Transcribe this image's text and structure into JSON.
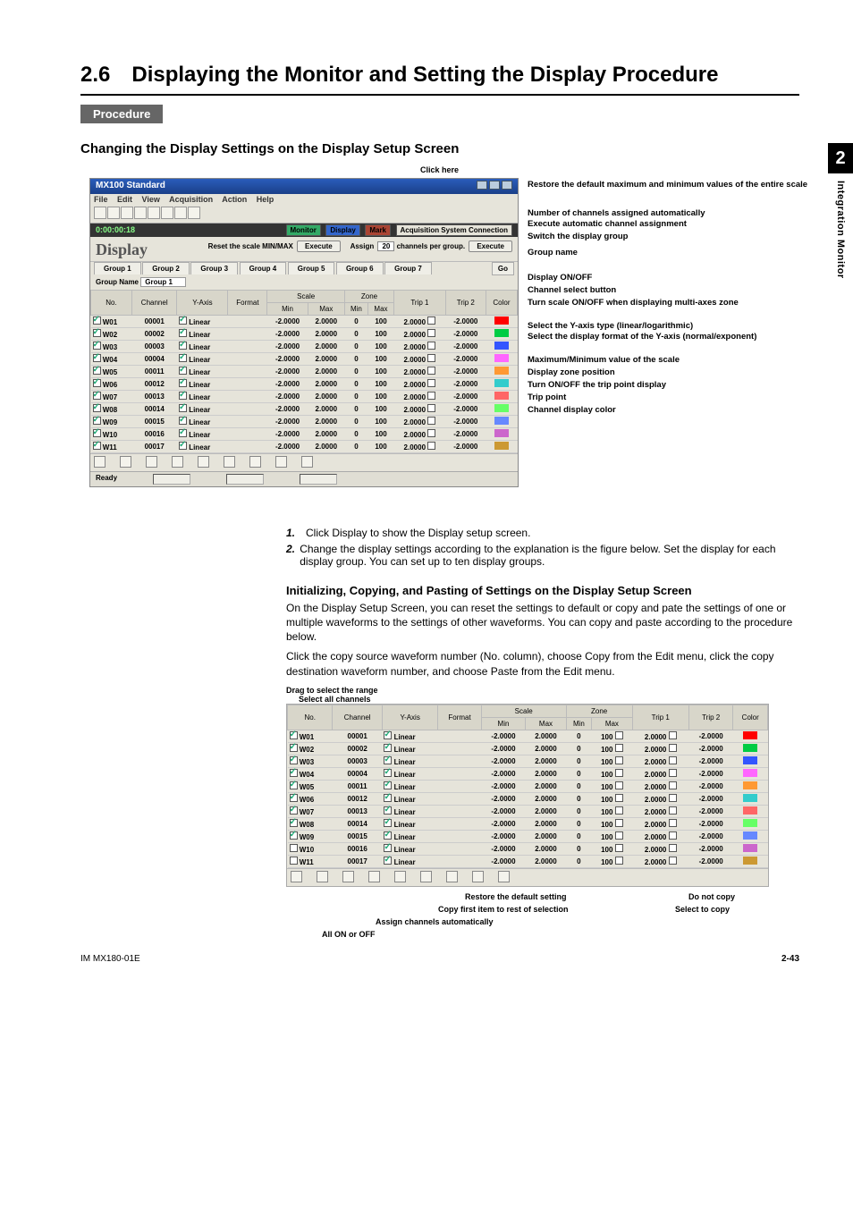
{
  "side_tab": {
    "number": "2",
    "label": "Integration Monitor"
  },
  "section": {
    "number": "2.6",
    "title": "Displaying the Monitor and Setting the Display Procedure"
  },
  "labels": {
    "procedure": "Procedure"
  },
  "subhead1": "Changing the Display Settings on the Display Setup Screen",
  "fig1": {
    "click_here": "Click here",
    "window_title": "MX100 Standard",
    "menu": [
      "File",
      "Edit",
      "View",
      "Acquisition",
      "Action",
      "Help"
    ],
    "time": "0:00:00:18",
    "top_buttons": {
      "monitor": "Monitor",
      "display": "Display",
      "mark": "Mark",
      "rest": "Acquisition  System  Connection"
    },
    "display_word": "Display",
    "reset_label": "Reset the scale MIN/MAX",
    "execute": "Execute",
    "assign_label": "Assign",
    "assign_value": "20",
    "assign_suffix": "channels per group.",
    "go_btn": "Go",
    "group_tabs": [
      "Group 1",
      "Group 2",
      "Group 3",
      "Group 4",
      "Group 5",
      "Group 6",
      "Group 7"
    ],
    "group_name_label": "Group Name",
    "group_name_value": "Group 1",
    "headers": [
      "No.",
      "Channel",
      "Y-Axis",
      "Format",
      "Scale Min",
      "Scale Max",
      "Zone Min",
      "Zone Max",
      "Trip 1",
      "Trip 2",
      "Color"
    ],
    "scale_hdr": "Scale",
    "zone_hdr": "Zone",
    "rows": [
      {
        "no": "W01",
        "ch": "00001",
        "yaxis": "Linear",
        "smin": "-2.0000",
        "smax": "2.0000",
        "zmin": "0",
        "zmax": "100",
        "t1": "2.0000",
        "t2": "-2.0000",
        "color": "#ff0000"
      },
      {
        "no": "W02",
        "ch": "00002",
        "yaxis": "Linear",
        "smin": "-2.0000",
        "smax": "2.0000",
        "zmin": "0",
        "zmax": "100",
        "t1": "2.0000",
        "t2": "-2.0000",
        "color": "#00cc44"
      },
      {
        "no": "W03",
        "ch": "00003",
        "yaxis": "Linear",
        "smin": "-2.0000",
        "smax": "2.0000",
        "zmin": "0",
        "zmax": "100",
        "t1": "2.0000",
        "t2": "-2.0000",
        "color": "#3355ff"
      },
      {
        "no": "W04",
        "ch": "00004",
        "yaxis": "Linear",
        "smin": "-2.0000",
        "smax": "2.0000",
        "zmin": "0",
        "zmax": "100",
        "t1": "2.0000",
        "t2": "-2.0000",
        "color": "#ff66ff"
      },
      {
        "no": "W05",
        "ch": "00011",
        "yaxis": "Linear",
        "smin": "-2.0000",
        "smax": "2.0000",
        "zmin": "0",
        "zmax": "100",
        "t1": "2.0000",
        "t2": "-2.0000",
        "color": "#ff9933"
      },
      {
        "no": "W06",
        "ch": "00012",
        "yaxis": "Linear",
        "smin": "-2.0000",
        "smax": "2.0000",
        "zmin": "0",
        "zmax": "100",
        "t1": "2.0000",
        "t2": "-2.0000",
        "color": "#33cccc"
      },
      {
        "no": "W07",
        "ch": "00013",
        "yaxis": "Linear",
        "smin": "-2.0000",
        "smax": "2.0000",
        "zmin": "0",
        "zmax": "100",
        "t1": "2.0000",
        "t2": "-2.0000",
        "color": "#ff6666"
      },
      {
        "no": "W08",
        "ch": "00014",
        "yaxis": "Linear",
        "smin": "-2.0000",
        "smax": "2.0000",
        "zmin": "0",
        "zmax": "100",
        "t1": "2.0000",
        "t2": "-2.0000",
        "color": "#66ff66"
      },
      {
        "no": "W09",
        "ch": "00015",
        "yaxis": "Linear",
        "smin": "-2.0000",
        "smax": "2.0000",
        "zmin": "0",
        "zmax": "100",
        "t1": "2.0000",
        "t2": "-2.0000",
        "color": "#6688ff"
      },
      {
        "no": "W10",
        "ch": "00016",
        "yaxis": "Linear",
        "smin": "-2.0000",
        "smax": "2.0000",
        "zmin": "0",
        "zmax": "100",
        "t1": "2.0000",
        "t2": "-2.0000",
        "color": "#cc66cc"
      },
      {
        "no": "W11",
        "ch": "00017",
        "yaxis": "Linear",
        "smin": "-2.0000",
        "smax": "2.0000",
        "zmin": "0",
        "zmax": "100",
        "t1": "2.0000",
        "t2": "-2.0000",
        "color": "#cc9933"
      }
    ],
    "status": "Ready",
    "annotations": [
      "Restore the default maximum and minimum values of the entire scale",
      "Number of channels assigned automatically",
      "Execute automatic channel assignment",
      "Switch the display group",
      "Group name",
      "Display ON/OFF",
      "Channel select button",
      "Turn scale ON/OFF when displaying multi-axes zone",
      "Select the Y-axis type (linear/logarithmic)",
      "Select the display format of the Y-axis (normal/exponent)",
      "Maximum/Minimum value of the scale",
      "Display zone position",
      "Turn ON/OFF the trip point display",
      "Trip point",
      "Channel display color"
    ]
  },
  "steps": [
    {
      "n": "1.",
      "t": "Click Display to show the Display setup screen."
    },
    {
      "n": "2.",
      "t": "Change the display settings according to the explanation is the figure below. Set the display for each display group. You can set up to ten display groups."
    }
  ],
  "inner_head": "Initializing, Copying, and Pasting of Settings on the Display Setup Screen",
  "body_paras": [
    "On the Display Setup Screen, you can reset the settings to default or copy and pate the settings of one or multiple waveforms to the settings of other waveforms. You can copy and paste according to the procedure below.",
    "Click the copy source waveform number (No. column), choose Copy from the Edit menu, click the copy destination waveform number, and choose Paste from the Edit menu."
  ],
  "fig2": {
    "top_labels": {
      "drag": "Drag to select the range",
      "select_all": "Select all channels"
    },
    "headers": [
      "No.",
      "Channel",
      "Y-Axis",
      "Format",
      "Min",
      "Max",
      "Min",
      "Max",
      "Trip 1",
      "Trip 2",
      "Color"
    ],
    "scale_hdr": "Scale",
    "zone_hdr": "Zone",
    "rows": [
      {
        "no": "W01",
        "ch": "00001",
        "on": true,
        "smin": "-2.0000",
        "smax": "2.0000",
        "zmin": "0",
        "zmax": "100",
        "t1": "2.0000",
        "t2": "-2.0000",
        "color": "#ff0000"
      },
      {
        "no": "W02",
        "ch": "00002",
        "on": true,
        "smin": "-2.0000",
        "smax": "2.0000",
        "zmin": "0",
        "zmax": "100",
        "t1": "2.0000",
        "t2": "-2.0000",
        "color": "#00cc44"
      },
      {
        "no": "W03",
        "ch": "00003",
        "on": true,
        "smin": "-2.0000",
        "smax": "2.0000",
        "zmin": "0",
        "zmax": "100",
        "t1": "2.0000",
        "t2": "-2.0000",
        "color": "#3355ff"
      },
      {
        "no": "W04",
        "ch": "00004",
        "on": true,
        "smin": "-2.0000",
        "smax": "2.0000",
        "zmin": "0",
        "zmax": "100",
        "t1": "2.0000",
        "t2": "-2.0000",
        "color": "#ff66ff"
      },
      {
        "no": "W05",
        "ch": "00011",
        "on": true,
        "smin": "-2.0000",
        "smax": "2.0000",
        "zmin": "0",
        "zmax": "100",
        "t1": "2.0000",
        "t2": "-2.0000",
        "color": "#ff9933"
      },
      {
        "no": "W06",
        "ch": "00012",
        "on": true,
        "smin": "-2.0000",
        "smax": "2.0000",
        "zmin": "0",
        "zmax": "100",
        "t1": "2.0000",
        "t2": "-2.0000",
        "color": "#33cccc"
      },
      {
        "no": "W07",
        "ch": "00013",
        "on": true,
        "smin": "-2.0000",
        "smax": "2.0000",
        "zmin": "0",
        "zmax": "100",
        "t1": "2.0000",
        "t2": "-2.0000",
        "color": "#ff6666"
      },
      {
        "no": "W08",
        "ch": "00014",
        "on": true,
        "smin": "-2.0000",
        "smax": "2.0000",
        "zmin": "0",
        "zmax": "100",
        "t1": "2.0000",
        "t2": "-2.0000",
        "color": "#66ff66"
      },
      {
        "no": "W09",
        "ch": "00015",
        "on": true,
        "smin": "-2.0000",
        "smax": "2.0000",
        "zmin": "0",
        "zmax": "100",
        "t1": "2.0000",
        "t2": "-2.0000",
        "color": "#6688ff"
      },
      {
        "no": "W10",
        "ch": "00016",
        "on": false,
        "smin": "-2.0000",
        "smax": "2.0000",
        "zmin": "0",
        "zmax": "100",
        "t1": "2.0000",
        "t2": "-2.0000",
        "color": "#cc66cc"
      },
      {
        "no": "W11",
        "ch": "00017",
        "on": false,
        "smin": "-2.0000",
        "smax": "2.0000",
        "zmin": "0",
        "zmax": "100",
        "t1": "2.0000",
        "t2": "-2.0000",
        "color": "#cc9933"
      }
    ],
    "yaxis_value": "Linear",
    "bottom_labels": {
      "restore": "Restore the default setting",
      "copy_first": "Copy first item to rest of selection",
      "assign": "Assign channels automatically",
      "all_on_off": "All ON or OFF",
      "do_not_copy": "Do not copy",
      "select_to_copy": "Select to copy"
    }
  },
  "footer": {
    "code": "IM MX180-01E",
    "page": "2-43"
  }
}
